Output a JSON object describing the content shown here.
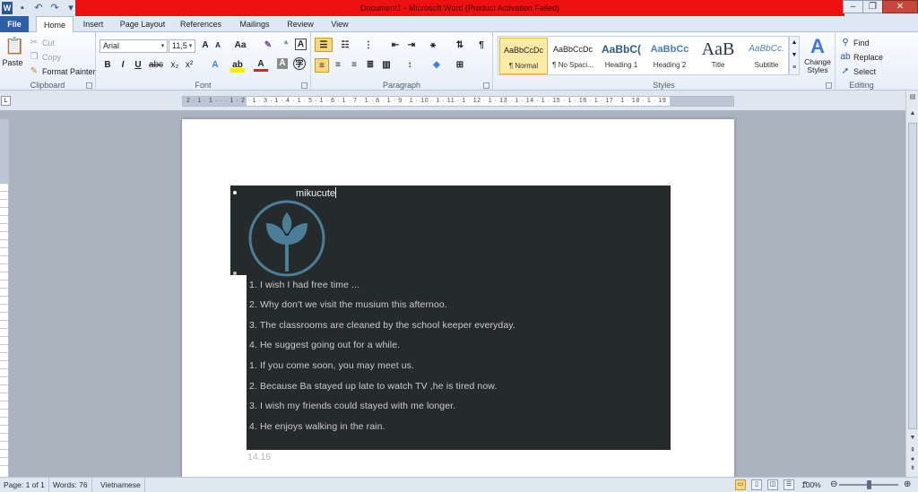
{
  "window": {
    "title": "Document1 - Microsoft Word (Product Activation Failed)",
    "qat_icons": [
      "word-icon",
      "save-icon",
      "undo-icon",
      "redo-icon",
      "customize-icon"
    ],
    "word_icon_letter": "W"
  },
  "tabs": [
    "File",
    "Home",
    "Insert",
    "Page Layout",
    "References",
    "Mailings",
    "Review",
    "View"
  ],
  "ribbon": {
    "clipboard": {
      "label": "Clipboard",
      "paste": "Paste",
      "cut": "Cut",
      "copy": "Copy",
      "format_painter": "Format Painter"
    },
    "font": {
      "label": "Font",
      "font_name": "Arial",
      "font_size": "11,5"
    },
    "paragraph": {
      "label": "Paragraph"
    },
    "styles": {
      "label": "Styles",
      "items": [
        {
          "sample": "AaBbCcDc",
          "name": "¶ Normal"
        },
        {
          "sample": "AaBbCcDc",
          "name": "¶ No Spaci..."
        },
        {
          "sample": "AaBbC(",
          "name": "Heading 1"
        },
        {
          "sample": "AaBbCc",
          "name": "Heading 2"
        },
        {
          "sample": "AaB",
          "name": "Title"
        },
        {
          "sample": "AaBbCc.",
          "name": "Subtitle"
        }
      ],
      "change_styles": "Change Styles"
    },
    "editing": {
      "label": "Editing",
      "find": "Find",
      "replace": "Replace",
      "select": "Select"
    }
  },
  "ruler": {
    "numbers": "2 · 1 · 1 · · · 1 · 2 · 1 · 3 · 1 · 4 · 1 · 5 · 1 · 6 · 1 · 7 · 1 · 8 · 1 · 9 · 1 · 10 · 1 · 11 · 1 · 12 · 1 · 13 · 1 · 14 · 1 · 15 · 1 · 16 · 1 · 17 · 1 · 18 · 1 · 19"
  },
  "document": {
    "title": "mikucute",
    "sentences": [
      "1. I wish I had free time ...",
      "2. Why don't we visit the musium this afternoo.",
      "3. The classrooms are cleaned by the school keeper everyday.",
      "4. He suggest going out for a while.",
      "1. If you come soon, you may meet us.",
      "2. Because Ba stayed up late to watch TV ,he is tired now.",
      "3. I wish my friends could stayed with me longer.",
      "4. He enjoys walking in the rain."
    ],
    "footer_text": "14.15",
    "colors": {
      "block": "#252a2b",
      "logo": "#4a7f97",
      "sentence_text": "#c9ccce"
    }
  },
  "status": {
    "page": "Page: 1 of 1",
    "words": "Words: 76",
    "language": "Vietnamese",
    "zoom": "100%"
  }
}
